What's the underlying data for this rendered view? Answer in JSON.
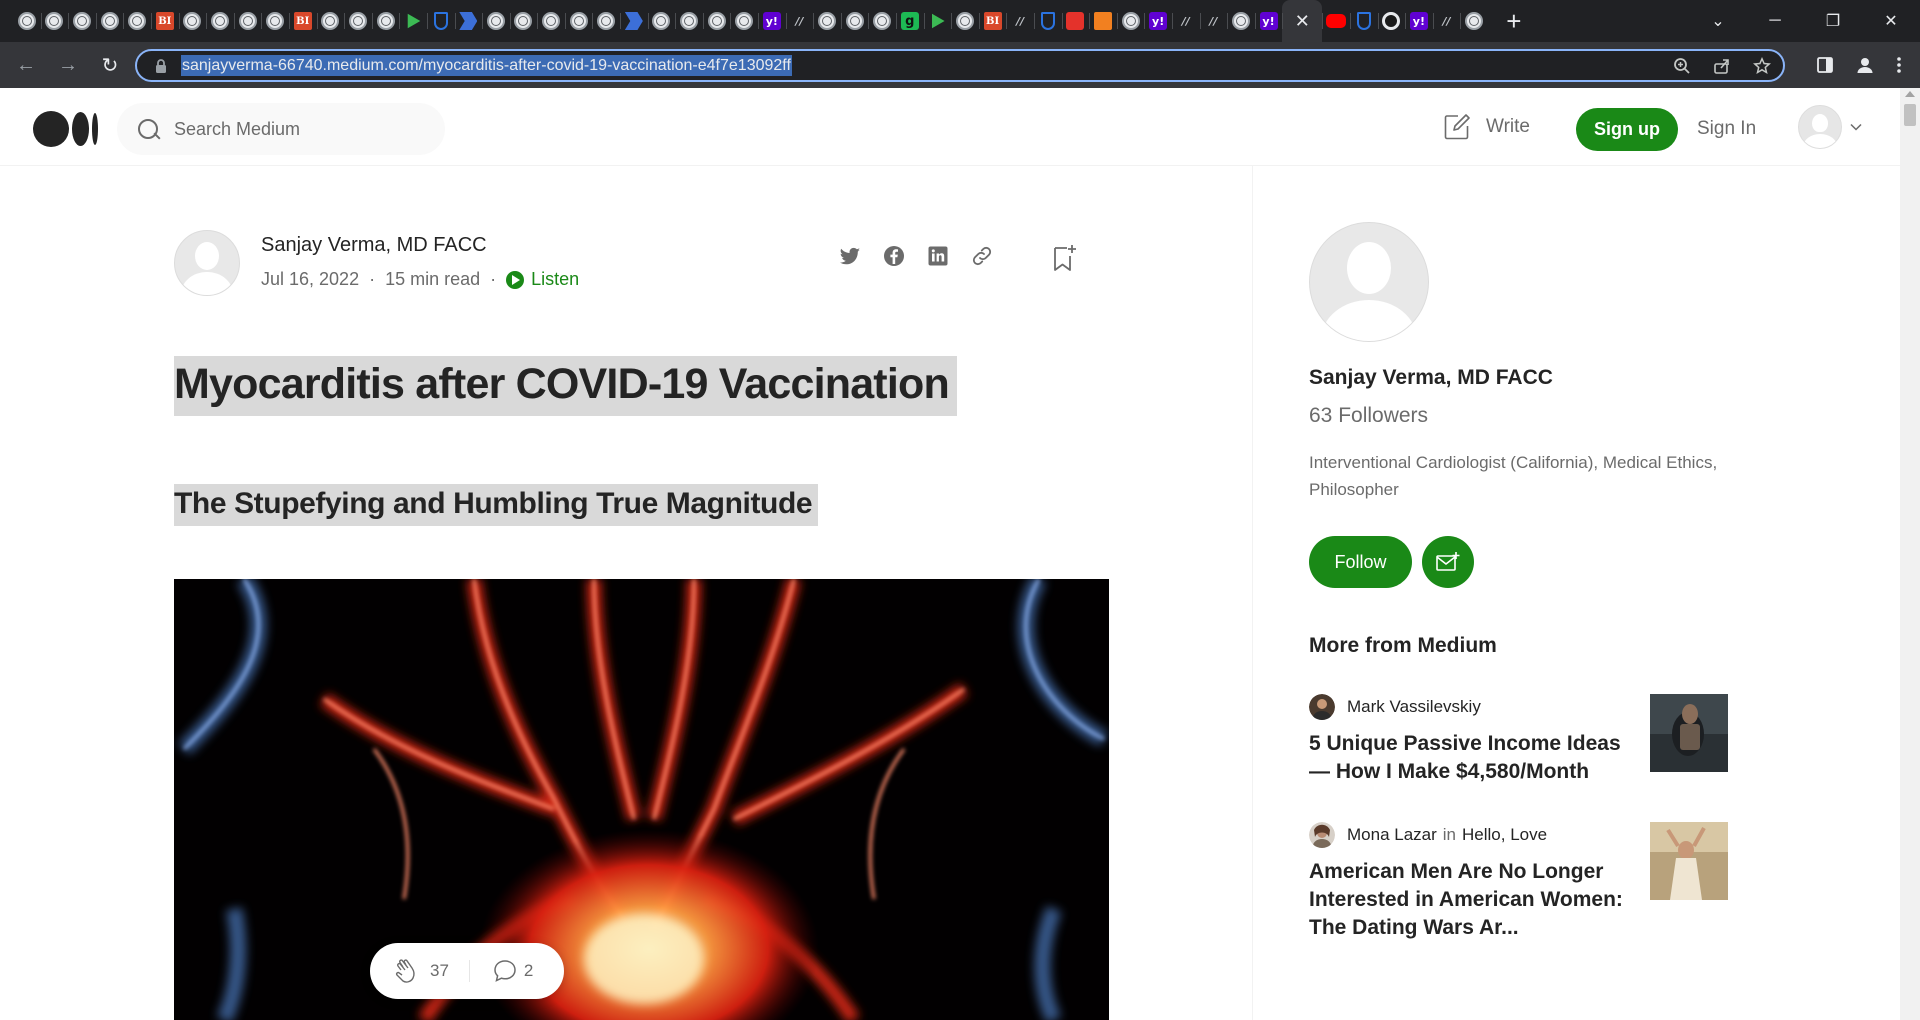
{
  "browser": {
    "url": "sanjayverma-66740.medium.com/myocarditis-after-covid-19-vaccination-e4f7e13092ff",
    "tab_favicons": [
      "edge",
      "globe",
      "globe",
      "globe",
      "globe",
      "bi",
      "globe",
      "globe",
      "globe",
      "globe",
      "bi",
      "globe",
      "globe",
      "globe",
      "play",
      "shield",
      "flag",
      "globe",
      "globe",
      "globe",
      "globe",
      "globe",
      "flag",
      "globe",
      "globe",
      "globe",
      "globe",
      "yahoo",
      "slash",
      "globe",
      "globe",
      "globe",
      "g",
      "play",
      "globe",
      "bi",
      "slash",
      "shield",
      "red",
      "orange",
      "globe",
      "yahoo",
      "slash",
      "slash",
      "globe",
      "yahoo"
    ],
    "tab_favicons_after_active": [
      "yt",
      "shield",
      "o",
      "yahoo",
      "slash",
      "globe"
    ],
    "active_tab_close": "✕",
    "new_tab": "+",
    "window_controls": {
      "tab_search": "⌄",
      "minimize": "─",
      "restore": "❐",
      "close": "✕"
    },
    "nav": {
      "back": "←",
      "forward": "→",
      "reload": "↻"
    }
  },
  "header": {
    "search_placeholder": "Search Medium",
    "write_label": "Write",
    "signup_label": "Sign up",
    "signin_label": "Sign In"
  },
  "article": {
    "author": "Sanjay Verma, MD FACC",
    "date": "Jul 16, 2022",
    "read_time": "15 min read",
    "dot": "·",
    "listen_label": "Listen",
    "title": "Myocarditis after COVID-19 Vaccination",
    "subtitle": "The Stupefying and Humbling True Magnitude",
    "share_icons": [
      "twitter-icon",
      "facebook-icon",
      "linkedin-icon",
      "link-icon"
    ],
    "claps": "37",
    "responses": "2"
  },
  "sidebar": {
    "author": "Sanjay Verma, MD FACC",
    "followers": "63 Followers",
    "bio": "Interventional Cardiologist (California), Medical Ethics, Philosopher",
    "follow_label": "Follow",
    "more_heading": "More from Medium",
    "recommendations": [
      {
        "author": "Mark Vassilevskiy",
        "in_label": "",
        "publication": "",
        "title": "5 Unique Passive Income Ideas — How I Make $4,580/Month"
      },
      {
        "author": "Mona Lazar",
        "in_label": "in",
        "publication": "Hello, Love",
        "title": "American Men Are No Longer Interested in American Women: The Dating Wars Ar..."
      }
    ]
  },
  "colors": {
    "accent": "#1a8917",
    "text": "#242424",
    "muted": "#6b6b6b",
    "selection": "#d9d9d9",
    "chrome_dark": "#202124",
    "chrome_toolbar": "#35363a",
    "omnibox_focus": "#8ab4f8"
  }
}
